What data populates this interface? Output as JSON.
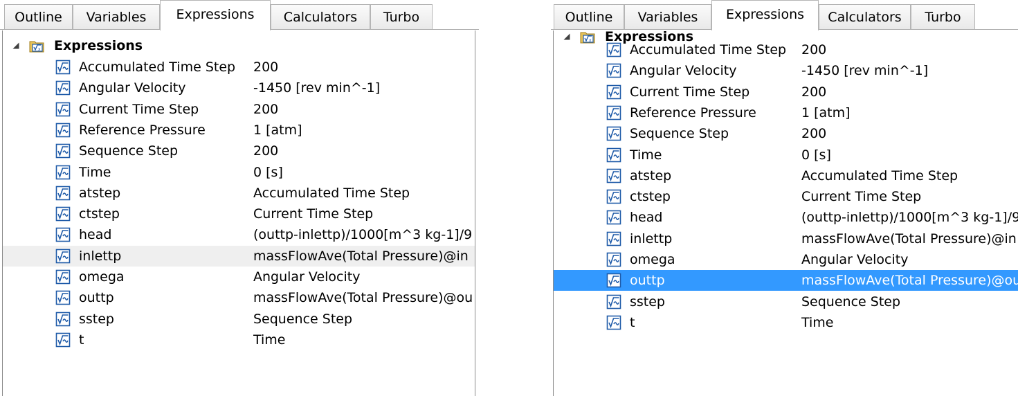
{
  "tabs": [
    "Outline",
    "Variables",
    "Expressions",
    "Calculators",
    "Turbo"
  ],
  "active_tab": "Expressions",
  "tree": {
    "root_label": "Expressions",
    "items": [
      {
        "name": "Accumulated Time Step",
        "value": "200"
      },
      {
        "name": "Angular Velocity",
        "value": "-1450 [rev min^-1]"
      },
      {
        "name": "Current Time Step",
        "value": "200"
      },
      {
        "name": "Reference Pressure",
        "value": "1 [atm]"
      },
      {
        "name": "Sequence Step",
        "value": "200"
      },
      {
        "name": "Time",
        "value": "0 [s]"
      },
      {
        "name": "atstep",
        "value": "Accumulated Time Step"
      },
      {
        "name": "ctstep",
        "value": "Current Time Step"
      },
      {
        "name": "head",
        "value": "(outtp-inlettp)/1000[m^3 kg-1]/9"
      },
      {
        "name": "inlettp",
        "value": "massFlowAve(Total Pressure)@in"
      },
      {
        "name": "omega",
        "value": "Angular Velocity"
      },
      {
        "name": "outtp",
        "value": "massFlowAve(Total Pressure)@ou"
      },
      {
        "name": "sstep",
        "value": "Sequence Step"
      },
      {
        "name": "t",
        "value": "Time"
      }
    ]
  },
  "panels": [
    {
      "id": "left",
      "highlighted_item": "inlettp",
      "highlight_style": "hover"
    },
    {
      "id": "right",
      "highlighted_item": "outtp",
      "highlight_style": "selected"
    }
  ],
  "colors": {
    "selection": "#3399ff",
    "hover": "#efefef",
    "icon_blue": "#1e5aa8"
  },
  "icons": {
    "root": "expressions-folder-icon",
    "item": "expression-icon",
    "expander": "expand-triangle-icon"
  }
}
